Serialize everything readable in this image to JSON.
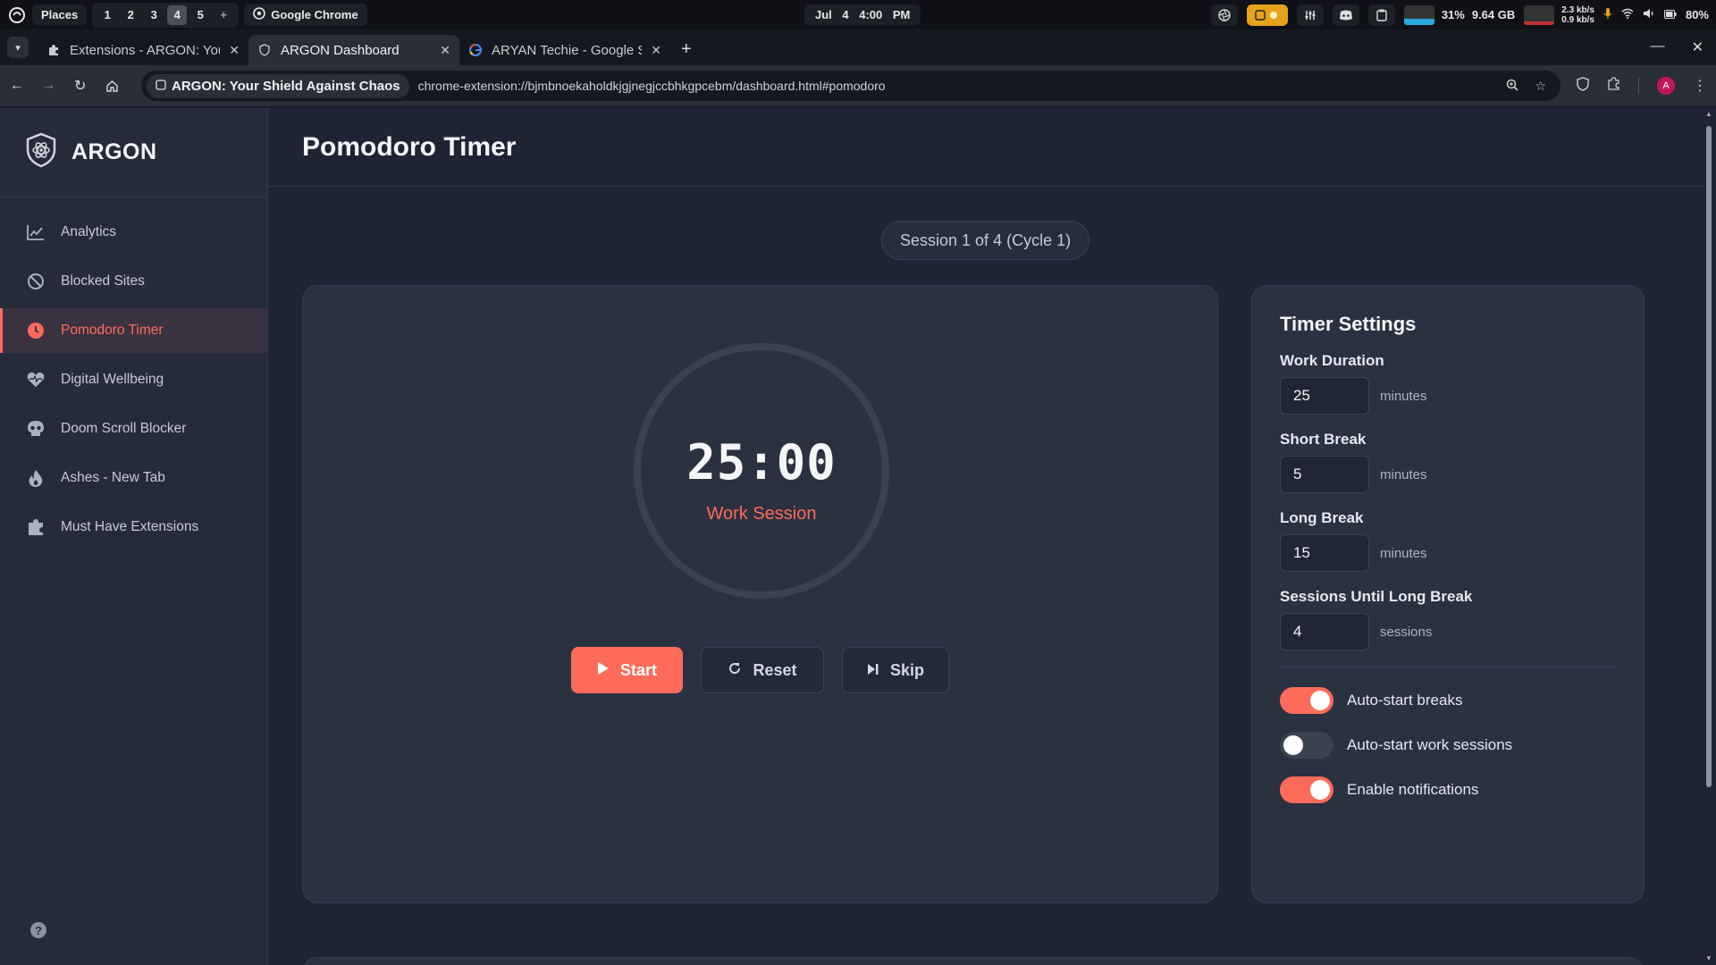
{
  "os_bar": {
    "places_label": "Places",
    "workspaces": [
      "1",
      "2",
      "3",
      "4",
      "5"
    ],
    "active_workspace": "4",
    "add_workspace": "+",
    "app_label": "Google Chrome",
    "date": "Jul 4",
    "time": "4:00 PM",
    "cpu": "31%",
    "memory": "9.64 GB",
    "net_down": "2.3 kb/s",
    "net_up": "0.9 kb/s",
    "battery": "80%"
  },
  "tabs": [
    {
      "title": "Extensions - ARGON: Your Shield Against Chaos",
      "icon": "puzzle-icon",
      "active": false
    },
    {
      "title": "ARGON Dashboard",
      "icon": "shield-icon",
      "active": true
    },
    {
      "title": "ARYAN Techie - Google Search",
      "icon": "google-icon",
      "active": false
    }
  ],
  "address_bar": {
    "site_chip": "ARGON: Your Shield Against Chaos",
    "url": "chrome-extension://bjmbnoekaholdkjgjnegjccbhkgpcebm/dashboard.html#pomodoro",
    "profile_initial": "A"
  },
  "sidebar": {
    "brand": "ARGON",
    "items": [
      {
        "label": "Analytics",
        "icon": "chart-line-icon"
      },
      {
        "label": "Blocked Sites",
        "icon": "ban-icon"
      },
      {
        "label": "Pomodoro Timer",
        "icon": "clock-icon",
        "active": true
      },
      {
        "label": "Digital Wellbeing",
        "icon": "heart-pulse-icon"
      },
      {
        "label": "Doom Scroll Blocker",
        "icon": "skull-icon"
      },
      {
        "label": "Ashes - New Tab",
        "icon": "fire-icon"
      },
      {
        "label": "Must Have Extensions",
        "icon": "puzzle-icon"
      }
    ],
    "help": "?"
  },
  "main": {
    "title": "Pomodoro Timer",
    "session_indicator": "Session 1 of 4 (Cycle 1)",
    "timer": {
      "minutes": "25",
      "seconds": "00",
      "mode_label": "Work Session",
      "progress_fraction": 0
    },
    "buttons": {
      "start": "Start",
      "reset": "Reset",
      "skip": "Skip"
    }
  },
  "settings": {
    "title": "Timer Settings",
    "fields": [
      {
        "label": "Work Duration",
        "value": "25",
        "unit": "minutes"
      },
      {
        "label": "Short Break",
        "value": "5",
        "unit": "minutes"
      },
      {
        "label": "Long Break",
        "value": "15",
        "unit": "minutes"
      },
      {
        "label": "Sessions Until Long Break",
        "value": "4",
        "unit": "sessions"
      }
    ],
    "toggles": [
      {
        "label": "Auto-start breaks",
        "on": true
      },
      {
        "label": "Auto-start work sessions",
        "on": false
      },
      {
        "label": "Enable notifications",
        "on": true
      }
    ]
  },
  "colors": {
    "accent": "#ff6b5a",
    "background": "#1e2433",
    "card": "#2a3140",
    "sidebar": "#252b39"
  }
}
